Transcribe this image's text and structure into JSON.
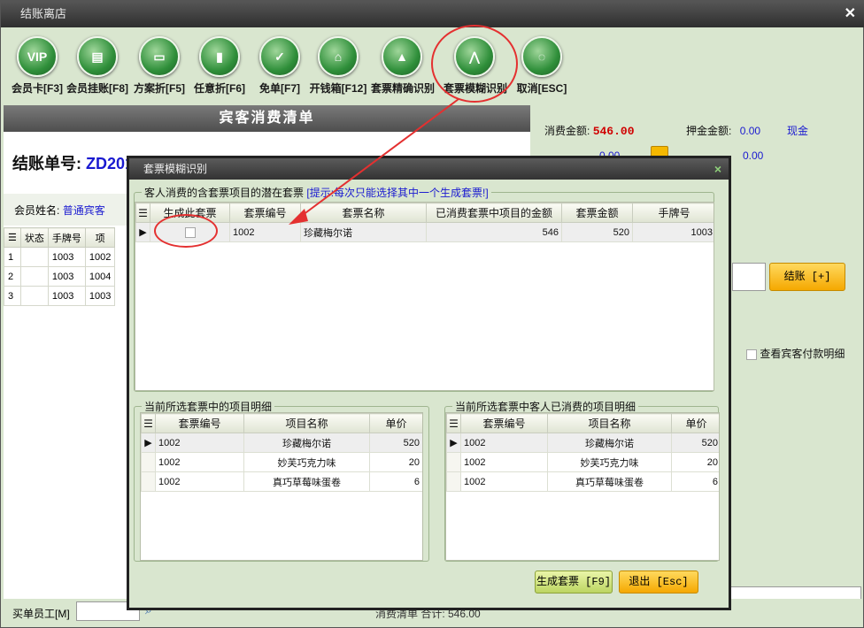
{
  "window": {
    "title": "结账离店",
    "close": "✕"
  },
  "toolbar": [
    {
      "label": "会员卡[F3]",
      "icon": "vip-card-icon",
      "glyph": "VIP"
    },
    {
      "label": "会员挂账[F8]",
      "icon": "member-credit-icon",
      "glyph": "▤"
    },
    {
      "label": "方案折[F5]",
      "icon": "plan-discount-icon",
      "glyph": "▭"
    },
    {
      "label": "任意折[F6]",
      "icon": "any-discount-icon",
      "glyph": "▮"
    },
    {
      "label": "免单[F7]",
      "icon": "free-bill-icon",
      "glyph": "✓"
    },
    {
      "label": "开钱箱[F12]",
      "icon": "cash-drawer-icon",
      "glyph": "⌂"
    },
    {
      "label": "套票精确识别",
      "icon": "package-exact-icon",
      "glyph": "▲"
    },
    {
      "label": "套票模糊识别",
      "icon": "package-fuzzy-icon",
      "glyph": "⋀"
    },
    {
      "label": "取消[ESC]",
      "icon": "cancel-icon",
      "glyph": "◌"
    }
  ],
  "bill": {
    "header": "宾客消费清单",
    "no_label": "结账单号:",
    "no_value": "ZD201",
    "member_label": "会员姓名:",
    "member_value": "普通宾客"
  },
  "left_grid": {
    "columns": [
      "状态",
      "手牌号",
      "项"
    ],
    "rows": [
      [
        "1",
        "",
        "1003",
        "1002"
      ],
      [
        "2",
        "",
        "1003",
        "1004"
      ],
      [
        "3",
        "",
        "1003",
        "1003"
      ]
    ]
  },
  "summary": {
    "consume_label": "消费金额:",
    "consume_value": "546.00",
    "deposit_label": "押金金额:",
    "deposit_value": "0.00",
    "cash_label": "现金",
    "row2_value_a": "0.00",
    "row2_value_b": "0.00",
    "checkout_label": "结账 [+]",
    "view_detail_label": "查看宾客付款明细"
  },
  "bottom": {
    "staff_label": "买单员工[M]",
    "total_text": "消费清单  合计: 546.00"
  },
  "modal": {
    "title": "套票模糊识别",
    "close": "×",
    "top_group": {
      "legend": "客人消费的含套票项目的潜在套票",
      "hint": "[提示:每次只能选择其中一个生成套票!]",
      "columns": [
        "生成此套票",
        "套票编号",
        "套票名称",
        "已消费套票中项目的金额",
        "套票金额",
        "手牌号"
      ],
      "rows": [
        {
          "checked": false,
          "code": "1002",
          "name": "珍藏梅尔诺",
          "consumed": "546",
          "amount": "520",
          "hand_no": "1003"
        }
      ]
    },
    "left_group": {
      "legend": "当前所选套票中的项目明细",
      "columns": [
        "套票编号",
        "项目名称",
        "单价"
      ],
      "rows": [
        [
          "1002",
          "珍藏梅尔诺",
          "520"
        ],
        [
          "1002",
          "妙芙巧克力味",
          "20"
        ],
        [
          "1002",
          "真巧草莓味蛋卷",
          "6"
        ]
      ]
    },
    "right_group": {
      "legend": "当前所选套票中客人已消费的项目明细",
      "columns": [
        "套票编号",
        "项目名称",
        "单价"
      ],
      "rows": [
        [
          "1002",
          "珍藏梅尔诺",
          "520"
        ],
        [
          "1002",
          "妙芙巧克力味",
          "20"
        ],
        [
          "1002",
          "真巧草莓味蛋卷",
          "6"
        ]
      ]
    },
    "buttons": {
      "generate": "生成套票 [F9]",
      "exit": "退出 [Esc]"
    }
  }
}
